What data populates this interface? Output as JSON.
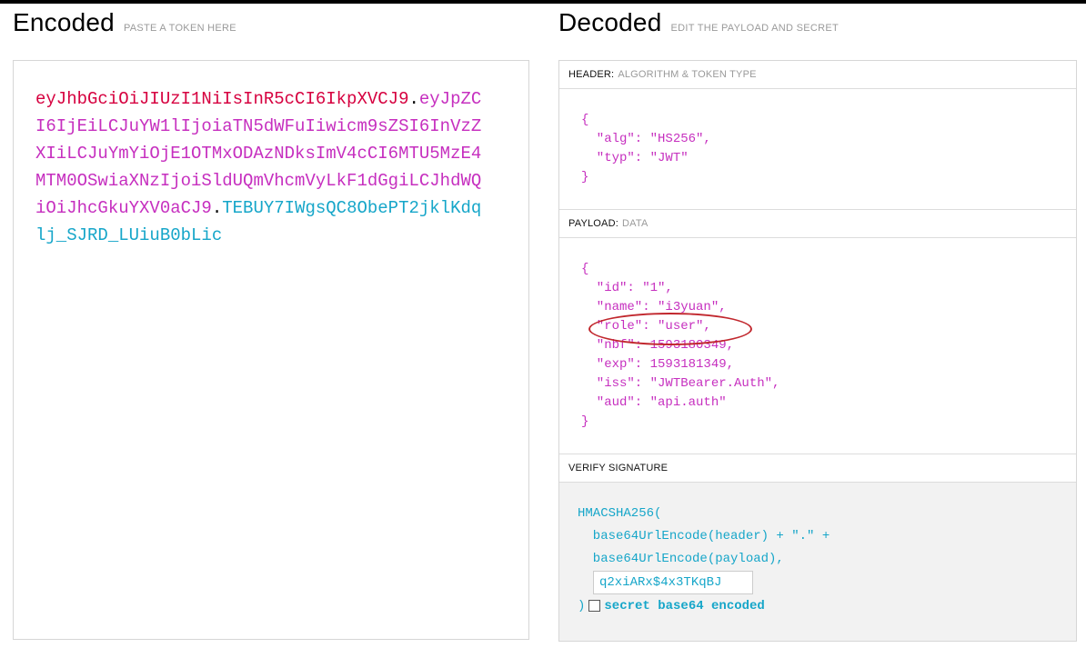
{
  "encoded": {
    "title": "Encoded",
    "subtitle": "PASTE A TOKEN HERE",
    "token_header": "eyJhbGciOiJIUzI1NiIsInR5cCI6IkpXVCJ9",
    "token_payload": "eyJpZCI6IjEiLCJuYW1lIjoiaTN5dWFuIiwicm9sZSI6InVzZXIiLCJuYmYiOjE1OTMxODAzNDksImV4cCI6MTU5MzE4MTM0OSwiaXNzIjoiSldUQmVhcmVyLkF1dGgiLCJhdWQiOiJhcGkuYXV0aCJ9",
    "token_signature": "TEBUY7IWgsQC8ObePT2jklKdqlj_SJRD_LUiuB0bLic",
    "dot": "."
  },
  "decoded": {
    "title": "Decoded",
    "subtitle": "EDIT THE PAYLOAD AND SECRET",
    "header_section": {
      "label": "HEADER:",
      "sublabel": "ALGORITHM & TOKEN TYPE",
      "lines": [
        "{",
        "  \"alg\": \"HS256\",",
        "  \"typ\": \"JWT\"",
        "}"
      ]
    },
    "payload_section": {
      "label": "PAYLOAD:",
      "sublabel": "DATA",
      "lines": [
        "{",
        "  \"id\": \"1\",",
        "  \"name\": \"i3yuan\",",
        "  \"role\": \"user\",",
        "  \"nbf\": 1593180349,",
        "  \"exp\": 1593181349,",
        "  \"iss\": \"JWTBearer.Auth\",",
        "  \"aud\": \"api.auth\"",
        "}"
      ]
    },
    "verify_section": {
      "label": "VERIFY SIGNATURE",
      "line1": "HMACSHA256(",
      "line2": "  base64UrlEncode(header) + \".\" +",
      "line3": "  base64UrlEncode(payload),",
      "secret_value": "q2xiARx$4x3TKqBJ",
      "close": ")",
      "checkbox_label": "secret base64 encoded",
      "checkbox_checked": false
    }
  },
  "colors": {
    "header": "#d6003f",
    "payload": "#c62fbf",
    "signature": "#16a6c9",
    "annotation": "#c1272d"
  }
}
